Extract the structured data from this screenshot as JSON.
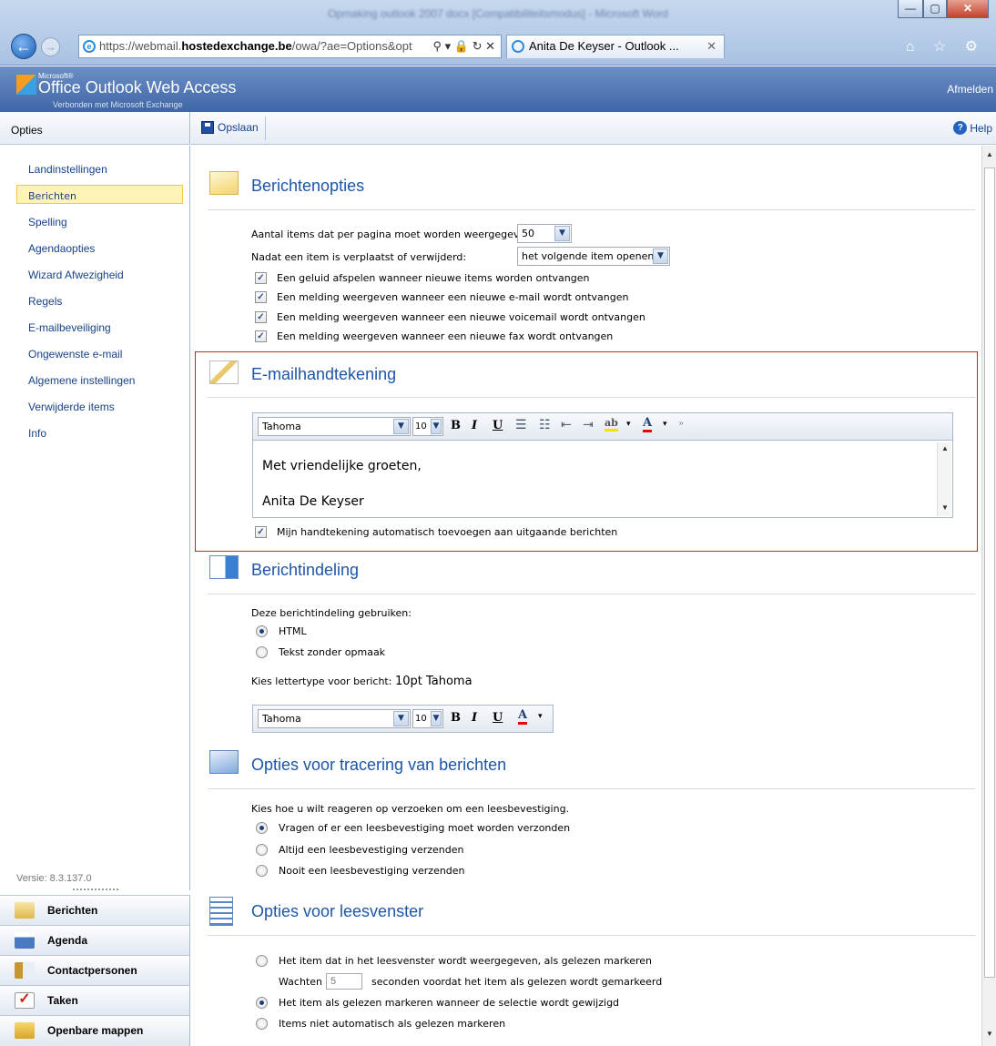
{
  "browser": {
    "window_title": "Opmaking outlook 2007 docx [Compatibiliteitsmodus] - Microsoft Word",
    "address_prefix": "https://webmail.",
    "address_domain": "hostedexchange.be",
    "address_rest": "/owa/?ae=Options&opt",
    "address_icons": "⚲ ▾ 🔒 ↻ ✕",
    "tab_title": "Anita De Keyser - Outlook ...",
    "tab_close": "✕",
    "window_buttons": [
      "—",
      "▢",
      "✕"
    ],
    "tool_icons": "⌂ ☆ ⚙"
  },
  "owa": {
    "logo_microsoft": "Microsoft®",
    "logo_title": "Office Outlook Web Access",
    "logo_sub": "Verbonden met Microsoft Exchange",
    "signout": "Afmelden"
  },
  "left": {
    "title": "Opties",
    "items": [
      "Landinstellingen",
      "Berichten",
      "Spelling",
      "Agendaopties",
      "Wizard Afwezigheid",
      "Regels",
      "E-mailbeveiliging",
      "Ongewenste e-mail",
      "Algemene instellingen",
      "Verwijderde items",
      "Info"
    ],
    "selected": "Berichten",
    "version": "Versie: 8.3.137.0",
    "modules": [
      "Berichten",
      "Agenda",
      "Contactpersonen",
      "Taken",
      "Openbare mappen"
    ]
  },
  "toolbar": {
    "save": "Opslaan",
    "help": "Help"
  },
  "messages": {
    "title": "Berichtenopties",
    "items_label": "Aantal items dat per pagina moet worden weergegeven:",
    "items_value": "50",
    "after_label": "Nadat een item is verplaatst of verwijderd:",
    "after_value": "het volgende item openen",
    "checks": [
      "Een geluid afspelen wanneer nieuwe items worden ontvangen",
      "Een melding weergeven wanneer een nieuwe e-mail wordt ontvangen",
      "Een melding weergeven wanneer een nieuwe voicemail wordt ontvangen",
      "Een melding weergeven wanneer een nieuwe fax wordt ontvangen"
    ]
  },
  "signature": {
    "title": "E-mailhandtekening",
    "font": "Tahoma",
    "size": "10",
    "line1": "Met vriendelijke groeten,",
    "line2": "Anita De Keyser",
    "auto_add": "Mijn handtekening automatisch toevoegen aan uitgaande berichten"
  },
  "format": {
    "title": "Berichtindeling",
    "use_label": "Deze berichtindeling gebruiken:",
    "opt_html": "HTML",
    "opt_text": "Tekst zonder opmaak",
    "font_label": "Kies lettertype voor bericht:",
    "font_value": "10pt Tahoma",
    "font": "Tahoma",
    "size": "10"
  },
  "tracking": {
    "title": "Opties voor tracering van berichten",
    "label": "Kies hoe u wilt reageren op verzoeken om een leesbevestiging.",
    "opts": [
      "Vragen of er een leesbevestiging moet worden verzonden",
      "Altijd een leesbevestiging verzenden",
      "Nooit een leesbevestiging verzenden"
    ]
  },
  "reading": {
    "title": "Opties voor leesvenster",
    "opt1": "Het item dat in het leesvenster wordt weergegeven, als gelezen markeren",
    "wait": "Wachten",
    "wait_value": "5",
    "wait_suffix": "seconden voordat het item als gelezen wordt gemarkeerd",
    "opt2": "Het item als gelezen markeren wanneer de selectie wordt gewijzigd",
    "opt3": "Items niet automatisch als gelezen markeren"
  }
}
